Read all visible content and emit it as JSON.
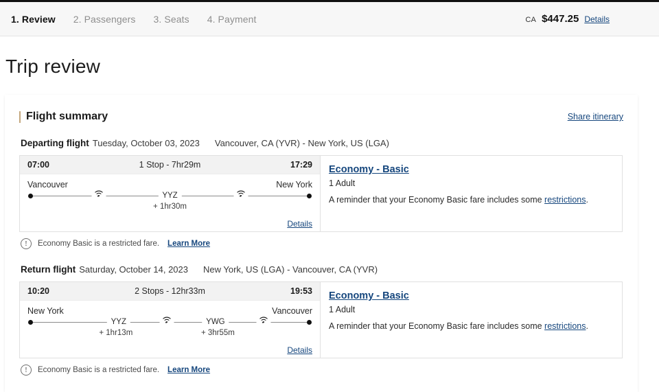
{
  "header": {
    "steps": [
      {
        "label": "1. Review",
        "active": true
      },
      {
        "label": "2. Passengers",
        "active": false
      },
      {
        "label": "3. Seats",
        "active": false
      },
      {
        "label": "4. Payment",
        "active": false
      }
    ],
    "currency": "CA",
    "price": "$447.25",
    "details_label": "Details"
  },
  "page": {
    "title": "Trip review"
  },
  "summary": {
    "title": "Flight summary",
    "share_label": "Share itinerary",
    "accent_color": "#c4a77d",
    "link_color": "#15467d"
  },
  "flights": [
    {
      "label": "Departing flight",
      "date": "Tuesday, October 03, 2023",
      "route": "Vancouver, CA (YVR) - New York, US (LGA)",
      "depart_time": "07:00",
      "arrive_time": "17:29",
      "stops_summary": "1 Stop - 7hr29m",
      "origin_city": "Vancouver",
      "destination_city": "New York",
      "stops": [
        {
          "code": "YYZ",
          "layover": "+ 1hr30m",
          "position": 50
        }
      ],
      "wifi_positions": [
        25,
        75
      ],
      "details_label": "Details",
      "fare_name": "Economy - Basic",
      "passengers": "1 Adult",
      "note_prefix": "A reminder that your Economy Basic fare includes some ",
      "note_link": "restrictions",
      "note_suffix": ".",
      "notice_text": "Economy Basic is a restricted fare.",
      "notice_link": "Learn More"
    },
    {
      "label": "Return flight",
      "date": "Saturday, October 14, 2023",
      "route": "New York, US (LGA) - Vancouver, CA (YVR)",
      "depart_time": "10:20",
      "arrive_time": "19:53",
      "stops_summary": "2 Stops - 12hr33m",
      "origin_city": "New York",
      "destination_city": "Vancouver",
      "stops": [
        {
          "code": "YYZ",
          "layover": "+ 1hr13m",
          "position": 32
        },
        {
          "code": "YWG",
          "layover": "+ 3hr55m",
          "position": 66
        }
      ],
      "wifi_positions": [
        49,
        83
      ],
      "details_label": "Details",
      "fare_name": "Economy - Basic",
      "passengers": "1 Adult",
      "note_prefix": "A reminder that your Economy Basic fare includes some ",
      "note_link": "restrictions",
      "note_suffix": ".",
      "notice_text": "Economy Basic is a restricted fare.",
      "notice_link": "Learn More"
    }
  ],
  "icons": {
    "wifi": "wifi-icon",
    "warning": "exclamation-circle-icon",
    "accent": "accent-bar"
  }
}
